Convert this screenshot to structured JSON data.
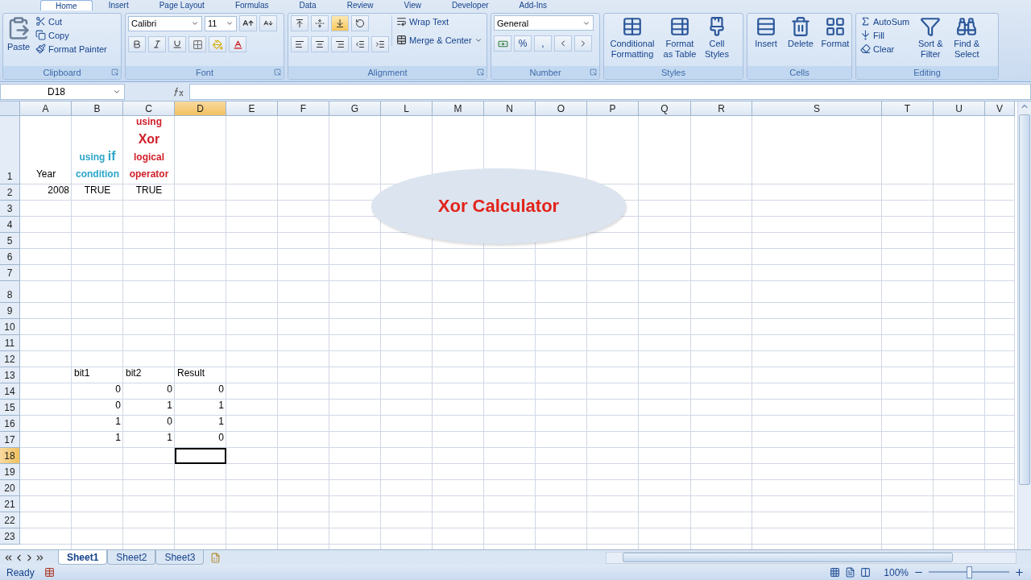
{
  "ribbon": {
    "tabs": [
      {
        "label": "Home",
        "selected": true
      },
      {
        "label": "Insert",
        "selected": false
      },
      {
        "label": "Page Layout",
        "selected": false
      },
      {
        "label": "Formulas",
        "selected": false
      },
      {
        "label": "Data",
        "selected": false
      },
      {
        "label": "Review",
        "selected": false
      },
      {
        "label": "View",
        "selected": false
      },
      {
        "label": "Developer",
        "selected": false
      },
      {
        "label": "Add-Ins",
        "selected": false
      }
    ],
    "groups": [
      {
        "kind": "clipboard",
        "label": "Clipboard",
        "big": "Paste",
        "small": [
          "Cut",
          "Copy",
          "Format Painter"
        ]
      },
      {
        "kind": "font",
        "label": "Font",
        "font": "Calibri",
        "size": "11"
      },
      {
        "kind": "alignment",
        "label": "Alignment",
        "vertical_align": [
          {
            "selected": false
          },
          {
            "selected": false
          },
          {
            "selected": true
          }
        ],
        "wrap": "Wrap Text",
        "merge": "Merge & Center"
      },
      {
        "kind": "number",
        "label": "Number",
        "format": "General",
        "symbols": [
          "%",
          ","
        ]
      },
      {
        "kind": "styles",
        "label": "Styles",
        "big": [
          "Conditional Formatting",
          "Format as Table",
          "Cell Styles"
        ]
      },
      {
        "kind": "cells",
        "label": "Cells",
        "big": [
          "Insert",
          "Delete",
          "Format"
        ]
      },
      {
        "kind": "editing",
        "label": "Editing",
        "small": [
          "AutoSum",
          "Fill",
          "Clear"
        ],
        "big": [
          "Sort & Filter",
          "Find & Select"
        ]
      }
    ]
  },
  "formula_bar": {
    "name_box": "D18"
  },
  "sheet": {
    "columns": [
      {
        "label": "A",
        "selected": false
      },
      {
        "label": "B",
        "selected": false
      },
      {
        "label": "C",
        "selected": false
      },
      {
        "label": "D",
        "selected": true
      },
      {
        "label": "E",
        "selected": false
      },
      {
        "label": "F",
        "selected": false
      },
      {
        "label": "G",
        "selected": false
      },
      {
        "label": "L",
        "selected": false
      },
      {
        "label": "M",
        "selected": false
      },
      {
        "label": "N",
        "selected": false
      },
      {
        "label": "O",
        "selected": false
      },
      {
        "label": "P",
        "selected": false
      },
      {
        "label": "Q",
        "selected": false
      },
      {
        "label": "R",
        "selected": false
      },
      {
        "label": "S",
        "selected": false
      },
      {
        "label": "T",
        "selected": false
      },
      {
        "label": "U",
        "selected": false
      },
      {
        "label": "V",
        "selected": false
      }
    ],
    "rows": [
      {
        "label": "1",
        "selected": false,
        "cells": [
          {
            "text": "Year",
            "kind": "center"
          },
          {
            "text": "using **if** condition",
            "kind": "center",
            "color": "#2ca6c9"
          },
          {
            "text": "using **Xor** logical operator",
            "kind": "center",
            "color": "#d0202a"
          }
        ]
      },
      {
        "label": "2",
        "selected": false,
        "cells": [
          {
            "text": "2008",
            "kind": "number"
          },
          {
            "text": "TRUE",
            "kind": "center"
          },
          {
            "text": "TRUE",
            "kind": "center"
          }
        ]
      },
      {
        "label": "3",
        "selected": false,
        "cells": []
      },
      {
        "label": "4",
        "selected": false,
        "cells": []
      },
      {
        "label": "5",
        "selected": false,
        "cells": []
      },
      {
        "label": "6",
        "selected": false,
        "cells": []
      },
      {
        "label": "7",
        "selected": false,
        "cells": []
      },
      {
        "label": "8",
        "selected": false,
        "cells": []
      },
      {
        "label": "9",
        "selected": false,
        "cells": []
      },
      {
        "label": "10",
        "selected": false,
        "cells": []
      },
      {
        "label": "11",
        "selected": false,
        "cells": []
      },
      {
        "label": "12",
        "selected": false,
        "cells": []
      },
      {
        "label": "13",
        "selected": false,
        "cells": [
          null,
          {
            "text": "bit1",
            "kind": "text"
          },
          {
            "text": "bit2",
            "kind": "text"
          },
          {
            "text": "Result",
            "kind": "text"
          }
        ]
      },
      {
        "label": "14",
        "selected": false,
        "cells": [
          null,
          {
            "text": "0",
            "kind": "number"
          },
          {
            "text": "0",
            "kind": "number"
          },
          {
            "text": "0",
            "kind": "number"
          }
        ]
      },
      {
        "label": "15",
        "selected": false,
        "cells": [
          null,
          {
            "text": "0",
            "kind": "number"
          },
          {
            "text": "1",
            "kind": "number"
          },
          {
            "text": "1",
            "kind": "number"
          }
        ]
      },
      {
        "label": "16",
        "selected": false,
        "cells": [
          null,
          {
            "text": "1",
            "kind": "number"
          },
          {
            "text": "0",
            "kind": "number"
          },
          {
            "text": "1",
            "kind": "number"
          }
        ]
      },
      {
        "label": "17",
        "selected": false,
        "cells": [
          null,
          {
            "text": "1",
            "kind": "number"
          },
          {
            "text": "1",
            "kind": "number"
          },
          {
            "text": "0",
            "kind": "number"
          }
        ]
      },
      {
        "label": "18",
        "selected": true,
        "cells": []
      },
      {
        "label": "19",
        "selected": false,
        "cells": []
      },
      {
        "label": "20",
        "selected": false,
        "cells": []
      },
      {
        "label": "21",
        "selected": false,
        "cells": []
      },
      {
        "label": "22",
        "selected": false,
        "cells": []
      },
      {
        "label": "23",
        "selected": false,
        "cells": []
      }
    ],
    "shape": {
      "text": "Xor Calculator"
    }
  },
  "sheet_tabs": [
    {
      "label": "Sheet1",
      "selected": true
    },
    {
      "label": "Sheet2",
      "selected": false
    },
    {
      "label": "Sheet3",
      "selected": false
    }
  ],
  "status_bar": {
    "status": "Ready",
    "zoom": "100%",
    "zoom_slider": {
      "level": 0.5
    }
  }
}
